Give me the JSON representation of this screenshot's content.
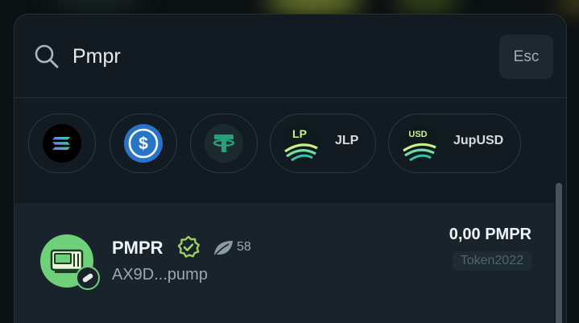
{
  "search": {
    "value": "Pmpr",
    "placeholder": "",
    "esc_label": "Esc"
  },
  "quick_tokens": [
    {
      "name": "SOL",
      "icon": "solana-logo",
      "label": ""
    },
    {
      "name": "USDC",
      "icon": "usdc-logo",
      "label": ""
    },
    {
      "name": "USDT",
      "icon": "tether-logo",
      "label": ""
    },
    {
      "name": "JLP",
      "icon": "jlp-logo",
      "label": "JLP",
      "logo_text": "LP"
    },
    {
      "name": "JupUSD",
      "icon": "jupusd-logo",
      "label": "JupUSD",
      "logo_text": "USD"
    }
  ],
  "results": [
    {
      "symbol": "PMPR",
      "address": "AX9D...pump",
      "organic_score": "58",
      "balance": "0,00 PMPR",
      "program": "Token2022",
      "verified": true
    }
  ],
  "colors": {
    "background": "#0b1012",
    "modal": "#121b22",
    "row_highlight": "#18232b",
    "verified": "#9fd35a",
    "token_avatar": "#6fd07a"
  }
}
